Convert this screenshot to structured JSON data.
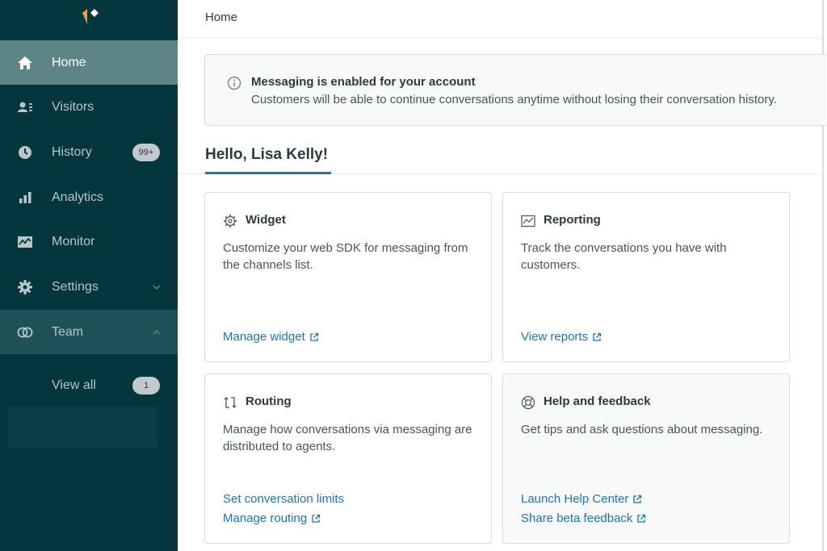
{
  "sidebar": {
    "nav": [
      {
        "label": "Home",
        "icon": "home-icon"
      },
      {
        "label": "Visitors",
        "icon": "visitors-icon"
      },
      {
        "label": "History",
        "icon": "history-icon",
        "badge": "99+"
      },
      {
        "label": "Analytics",
        "icon": "analytics-icon"
      },
      {
        "label": "Monitor",
        "icon": "monitor-icon"
      },
      {
        "label": "Settings",
        "icon": "settings-icon"
      },
      {
        "label": "Team",
        "icon": "team-icon"
      }
    ],
    "team_sub": {
      "label": "View all",
      "badge": "1"
    }
  },
  "header": {
    "breadcrumb": "Home"
  },
  "notice": {
    "title": "Messaging is enabled for your account",
    "body": "Customers will be able to continue conversations anytime without losing their conversation history."
  },
  "greeting": "Hello, Lisa Kelly!",
  "cards": {
    "widget": {
      "title": "Widget",
      "body": "Customize your web SDK for messaging from the channels list.",
      "links": [
        "Manage widget"
      ]
    },
    "reporting": {
      "title": "Reporting",
      "body": "Track the conversations you have with customers.",
      "links": [
        "View reports"
      ]
    },
    "routing": {
      "title": "Routing",
      "body": "Manage how conversations via messaging are distributed to agents.",
      "links": [
        "Set conversation limits",
        "Manage routing"
      ]
    },
    "help": {
      "title": "Help and feedback",
      "body": "Get tips and ask questions about messaging.",
      "links": [
        "Launch Help Center",
        "Share beta feedback"
      ]
    }
  },
  "colors": {
    "sidebar": "#03363d",
    "active": "#5e8586",
    "link": "#1f73b7",
    "accent_logo": "#f79a3e"
  }
}
